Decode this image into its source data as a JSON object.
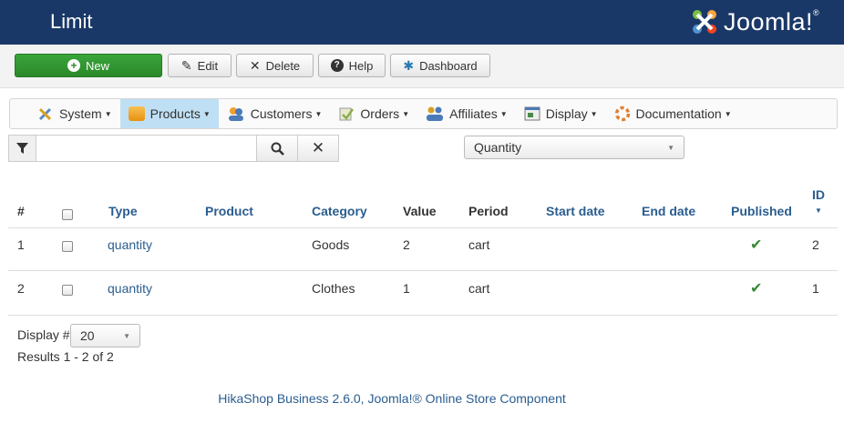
{
  "header": {
    "title": "Limit",
    "logo_text": "Joomla!",
    "logo_reg": "®"
  },
  "toolbar": {
    "new_label": "New",
    "edit_label": "Edit",
    "delete_label": "Delete",
    "help_label": "Help",
    "dashboard_label": "Dashboard"
  },
  "menu": {
    "items": [
      {
        "label": "System",
        "icon": "tools-icon",
        "color": "#5a8ac6"
      },
      {
        "label": "Products",
        "icon": "products-icon",
        "color": "#f0a020",
        "active": true
      },
      {
        "label": "Customers",
        "icon": "customers-icon",
        "color": "#4a7ab8"
      },
      {
        "label": "Orders",
        "icon": "orders-icon",
        "color": "#8ab04a"
      },
      {
        "label": "Affiliates",
        "icon": "affiliates-icon",
        "color": "#d8a020"
      },
      {
        "label": "Display",
        "icon": "display-icon",
        "color": "#4a8a4a"
      },
      {
        "label": "Documentation",
        "icon": "documentation-icon",
        "color": "#e08030"
      }
    ]
  },
  "filter": {
    "search_value": "",
    "quantity_select": "Quantity"
  },
  "table": {
    "headers": {
      "num": "#",
      "type": "Type",
      "product": "Product",
      "category": "Category",
      "value": "Value",
      "period": "Period",
      "start_date": "Start date",
      "end_date": "End date",
      "published": "Published",
      "id": "ID"
    },
    "rows": [
      {
        "num": "1",
        "type": "quantity",
        "product": "",
        "category": "Goods",
        "value": "2",
        "period": "cart",
        "start_date": "",
        "end_date": "",
        "published": true,
        "id": "2"
      },
      {
        "num": "2",
        "type": "quantity",
        "product": "",
        "category": "Clothes",
        "value": "1",
        "period": "cart",
        "start_date": "",
        "end_date": "",
        "published": true,
        "id": "1"
      }
    ]
  },
  "pagination": {
    "display_label": "Display #",
    "display_value": "20",
    "results": "Results 1 - 2 of 2"
  },
  "footer": {
    "text": "HikaShop Business 2.6.0, Joomla!® Online Store Component"
  },
  "colors": {
    "header_bg": "#1a3867",
    "link": "#2a5d8f",
    "new_button": "#2a882a",
    "active_menu": "#bfe0f4",
    "published_check": "#378a37"
  }
}
